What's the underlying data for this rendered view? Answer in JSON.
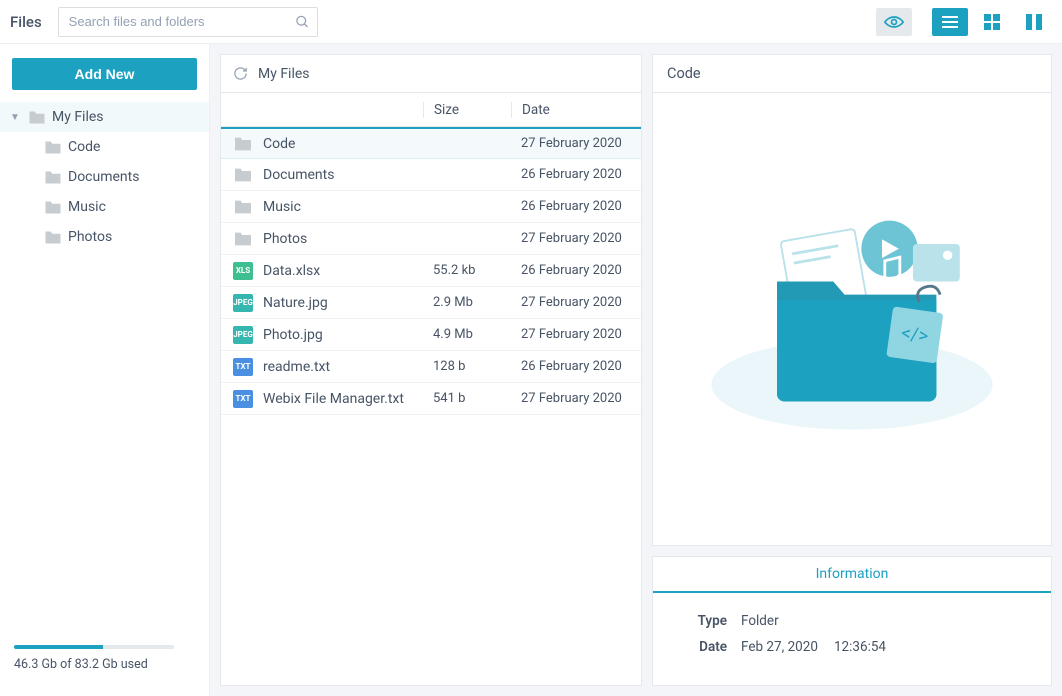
{
  "header": {
    "app_title": "Files",
    "search_placeholder": "Search files and folders"
  },
  "sidebar": {
    "add_new_label": "Add New",
    "tree_root": "My Files",
    "tree_children": [
      "Code",
      "Documents",
      "Music",
      "Photos"
    ],
    "storage_used_text": "46.3 Gb of 83.2 Gb used",
    "storage_percent": 55.6
  },
  "filelist": {
    "breadcrumb": "My Files",
    "columns": {
      "name": "",
      "size": "Size",
      "date": "Date"
    },
    "rows": [
      {
        "icon": "folder",
        "name": "Code",
        "size": "",
        "date": "27 February 2020",
        "selected": true
      },
      {
        "icon": "folder",
        "name": "Documents",
        "size": "",
        "date": "26 February 2020"
      },
      {
        "icon": "folder",
        "name": "Music",
        "size": "",
        "date": "26 February 2020"
      },
      {
        "icon": "folder",
        "name": "Photos",
        "size": "",
        "date": "27 February 2020"
      },
      {
        "icon": "xls",
        "name": "Data.xlsx",
        "size": "55.2 kb",
        "date": "26 February 2020"
      },
      {
        "icon": "jpeg",
        "name": "Nature.jpg",
        "size": "2.9 Mb",
        "date": "27 February 2020"
      },
      {
        "icon": "jpeg",
        "name": "Photo.jpg",
        "size": "4.9 Mb",
        "date": "27 February 2020"
      },
      {
        "icon": "txt",
        "name": "readme.txt",
        "size": "128 b",
        "date": "26 February 2020"
      },
      {
        "icon": "txt",
        "name": "Webix File Manager.txt",
        "size": "541 b",
        "date": "27 February 2020"
      }
    ]
  },
  "detail": {
    "title": "Code",
    "info_tab": "Information",
    "type_label": "Type",
    "type_value": "Folder",
    "date_label": "Date",
    "date_value": "Feb 27, 2020",
    "time_value": "12:36:54"
  },
  "icons": {
    "xls_label": "XLS",
    "jpeg_label": "JPEG",
    "txt_label": "TXT"
  }
}
